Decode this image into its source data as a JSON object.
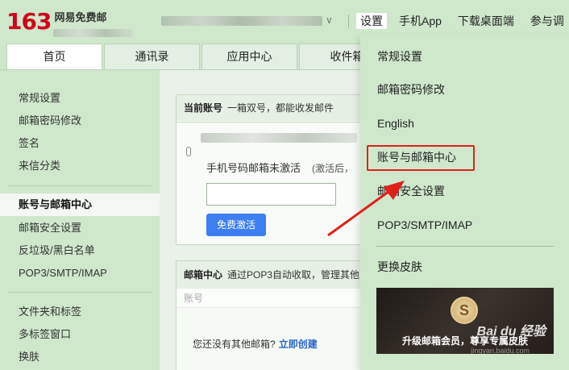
{
  "header": {
    "logo_number": "163",
    "logo_text": "网易免费邮",
    "account_chevron": "∨",
    "topnav": [
      {
        "label": "设置",
        "active": true
      },
      {
        "label": "手机App"
      },
      {
        "label": "下载桌面端"
      },
      {
        "label": "参与调"
      }
    ]
  },
  "tabs": [
    "首页",
    "通讯录",
    "应用中心",
    "收件箱"
  ],
  "sidebar": {
    "group1": [
      "常规设置",
      "邮箱密码修改",
      "签名",
      "来信分类"
    ],
    "group2": [
      "账号与邮箱中心",
      "邮箱安全设置",
      "反垃圾/黑白名单",
      "POP3/SMTP/IMAP"
    ],
    "group3": [
      "文件夹和标签",
      "多标签窗口",
      "换肤"
    ],
    "active": "账号与邮箱中心"
  },
  "main": {
    "panel1": {
      "title": "当前账号",
      "subtitle": "一箱双号，都能收发邮件",
      "status_text": "手机号码邮箱未激活",
      "status_note": "(激活后，",
      "button": "免费激活"
    },
    "panel2": {
      "title": "邮箱中心",
      "subtitle": "通过POP3自动收取，管理其他",
      "column": "账号",
      "empty_text": "您还没有其他邮箱?",
      "create_link": "立即创建"
    }
  },
  "dropdown": {
    "items": [
      "常规设置",
      "邮箱密码修改",
      "English",
      "账号与邮箱中心",
      "邮箱安全设置",
      "POP3/SMTP/IMAP"
    ],
    "skin_item": "更换皮肤",
    "skin_banner_text": "升级邮箱会员，尊享专属皮肤",
    "skin_coin": "S",
    "watermark": "Bai du 经验",
    "watermark_sub": "jingyan.baidu.com",
    "highlighted": "账号与邮箱中心"
  },
  "annotation": {
    "arrow_color": "#e0201d",
    "highlight_color": "#e0201d"
  }
}
